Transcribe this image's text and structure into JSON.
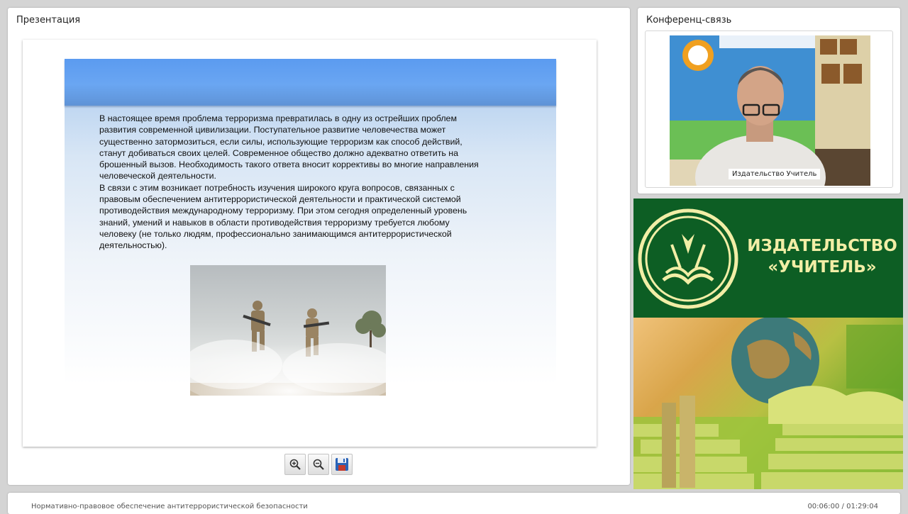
{
  "presentation_panel": {
    "title": "Презентация",
    "slide": {
      "paragraphs": [
        "В настоящее время проблема терроризма превратилась в одну из острейших проблем развития современной цивилизации. Поступательное развитие человечества может существенно затормозиться, если силы, использующие терроризм как способ действий, станут добиваться своих целей. Современное общество должно адекватно ответить на брошенный вызов. Необходимость такого ответа вносит коррективы во многие направления человеческой деятельности.",
        "В связи с этим возникает потребность изучения широкого круга вопросов, связанных с правовым обеспечением антитеррористической деятельности и практической системой противодействия международному терроризму. При этом сегодня определенный уровень знаний, умений и навыков в области противодействия терроризму требуется любому человеку (не только людям, профессионально занимающимся антитеррористической деятельностью)."
      ]
    },
    "toolbar": {
      "zoom_in_icon": "zoom-in-icon",
      "zoom_out_icon": "zoom-out-icon",
      "save_icon": "floppy-disk-icon"
    }
  },
  "conference_panel": {
    "title": "Конференц-связь",
    "video_caption": "Издательство Учитель"
  },
  "publisher_logo": {
    "line1": "ИЗДАТЕЛЬСТВО",
    "line2": "«УЧИТЕЛЬ»",
    "colors": {
      "green": "#0d5e24",
      "cream": "#f2eea6"
    }
  },
  "footer": {
    "course_title": "Нормативно-правовое обеспечение антитеррористической безопасности",
    "time": "00:06:00 / 01:29:04"
  }
}
